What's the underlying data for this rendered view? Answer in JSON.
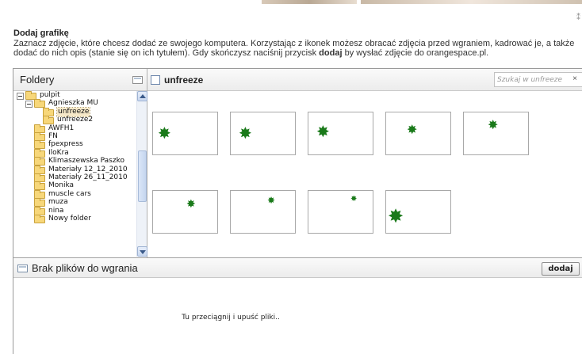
{
  "dialog": {
    "title": "Dodaj grafikę",
    "desc_part1": "Zaznacz zdjęcie, które chcesz dodać ze swojego komputera. Korzystając z ikonek możesz obracać zdjęcia przed wgraniem, kadrować je, a także dodać do nich opis (stanie się on ich tytułem). Gdy skończysz naciśnij przycisk ",
    "desc_bold": "dodaj",
    "desc_part2": " by wysłać zdjęcie do orangespace.pl.",
    "close_icon": "close-icon"
  },
  "folders_panel": {
    "title": "Foldery",
    "tree": [
      {
        "label": "pulpit",
        "expanded": true,
        "selected": false
      },
      {
        "label": "Agnieszka MU",
        "expanded": true,
        "selected": false
      },
      {
        "label": "unfreeze",
        "selected": true
      },
      {
        "label": "unfreeze2",
        "selected": false
      },
      {
        "label": "AWFH1",
        "selected": false
      },
      {
        "label": "FN",
        "selected": false
      },
      {
        "label": "fpexpress",
        "selected": false
      },
      {
        "label": "IloKra",
        "selected": false
      },
      {
        "label": "Klimaszewska Paszko",
        "selected": false
      },
      {
        "label": "Materiały 12_12_2010",
        "selected": false
      },
      {
        "label": "Materiały 26_11_2010",
        "selected": false
      },
      {
        "label": "Monika",
        "selected": false
      },
      {
        "label": "muscle cars",
        "selected": false
      },
      {
        "label": "muza",
        "selected": false
      },
      {
        "label": "nina",
        "selected": false
      },
      {
        "label": "Nowy folder",
        "selected": false
      }
    ]
  },
  "content_panel": {
    "folder_name": "unfreeze",
    "search_placeholder": "Szukaj w unfreeze",
    "clear_label": "×",
    "thumbnails": [
      {
        "icon": "leaf-icon"
      },
      {
        "icon": "leaf-icon"
      },
      {
        "icon": "leaf-icon"
      },
      {
        "icon": "leaf-icon"
      },
      {
        "icon": "leaf-icon"
      },
      {
        "icon": "leaf-icon"
      },
      {
        "icon": "leaf-icon"
      },
      {
        "icon": "leaf-icon"
      },
      {
        "icon": "leaf-icon"
      }
    ]
  },
  "upload_panel": {
    "status": "Brak plików do wgrania",
    "add_label": "dodaj",
    "drop_hint": "Tu przeciągnij i upuść pliki.."
  },
  "colors": {
    "leaf": "#1a7a1a",
    "folder": "#f7d77a",
    "selection": "#f6e8c8"
  }
}
